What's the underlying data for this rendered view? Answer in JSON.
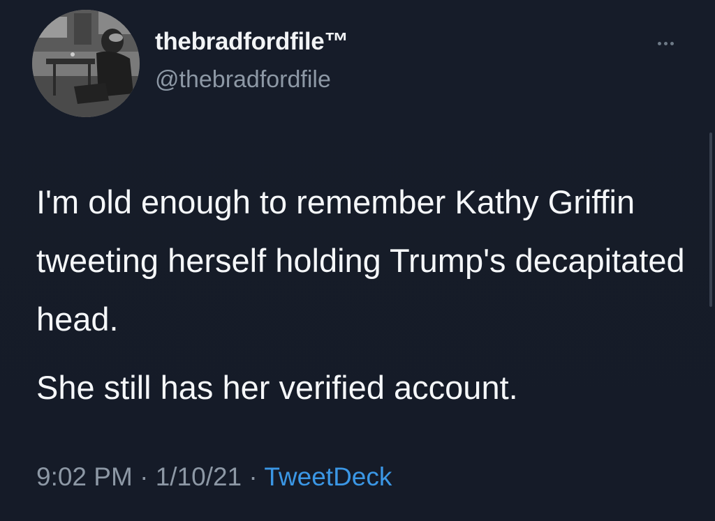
{
  "tweet": {
    "author": {
      "display_name": "thebradfordfile™",
      "username": "@thebradfordfile"
    },
    "more_icon": "more-horizontal-icon",
    "text": {
      "paragraph1": "I'm old enough to remember Kathy Griffin tweeting herself holding Trump's decapitated head.",
      "paragraph2": "She still has her verified account."
    },
    "meta": {
      "time": "9:02 PM",
      "separator": " · ",
      "date": "1/10/21",
      "source": "TweetDeck"
    }
  },
  "colors": {
    "background": "#161c29",
    "text_primary": "#f5f7f9",
    "text_secondary": "#8d98a5",
    "link": "#3b97e5"
  }
}
